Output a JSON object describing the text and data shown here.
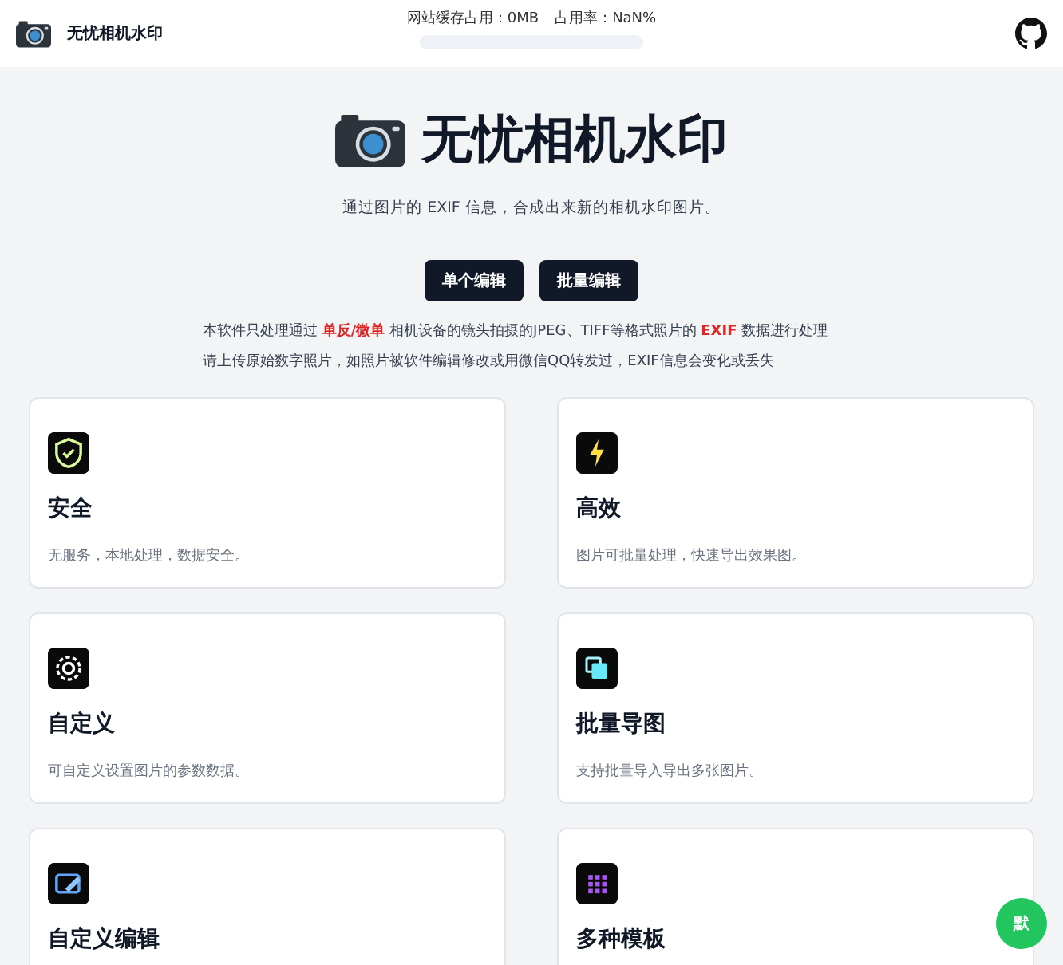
{
  "header": {
    "app_name": "无忧相机水印",
    "cache_label": "网站缓存占用：0MB",
    "usage_label": "占用率：NaN%",
    "cache_bar": {
      "level": 0
    }
  },
  "hero": {
    "title": "无忧相机水印",
    "subtitle": "通过图片的 EXIF 信息，合成出来新的相机水印图片。",
    "buttons": [
      "单个编辑",
      "批量编辑"
    ],
    "notice": [
      "本软件只处理通过 **单反/微单** 相机设备的镜头拍摄的JPEG、TIFF等格式照片的 **EXIF** 数据进行处理",
      "请上传原始数字照片，如照片被软件编辑修改或用微信QQ转发过，EXIF信息会变化或丢失"
    ]
  },
  "features": [
    {
      "kind": "shield",
      "title": "安全",
      "description": "无服务，本地处理，数据安全。"
    },
    {
      "kind": "bolt",
      "title": "高效",
      "description": "图片可批量处理，快速导出效果图。"
    },
    {
      "kind": "gear",
      "title": "自定义",
      "description": "可自定义设置图片的参数数据。"
    },
    {
      "kind": "layers",
      "title": "批量导图",
      "description": "支持批量导入导出多张图片。"
    },
    {
      "kind": "edit",
      "title": "自定义编辑"
    },
    {
      "kind": "grid",
      "title": "多种模板"
    }
  ],
  "float_button": "默"
}
